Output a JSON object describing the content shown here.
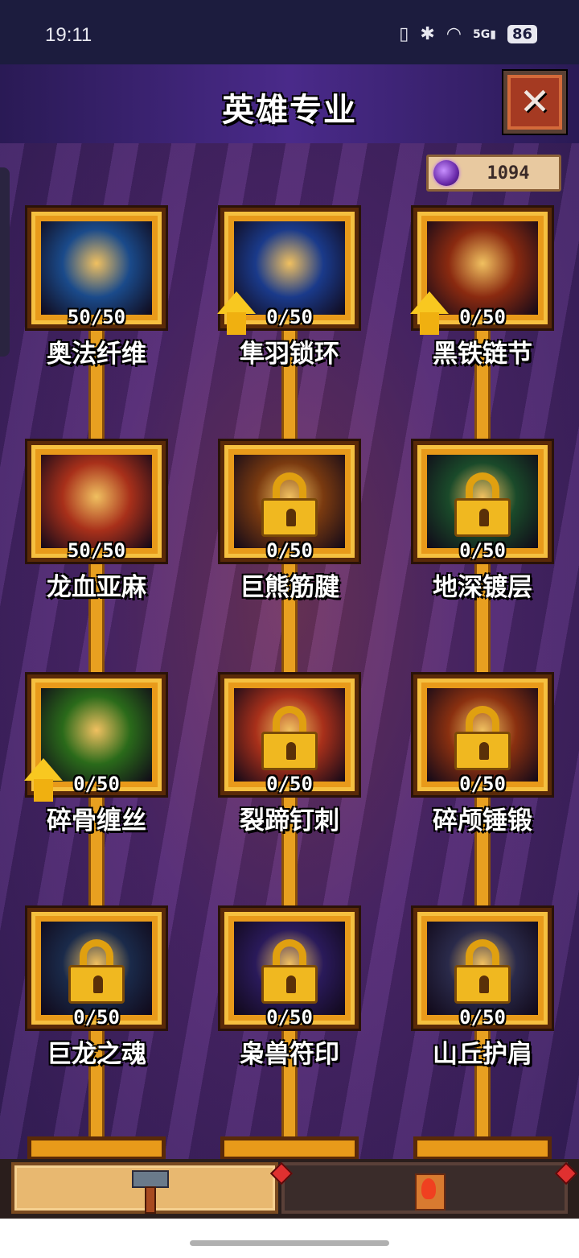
{
  "status_bar": {
    "time": "19:11",
    "icons": [
      "vibrate-icon",
      "bluetooth-icon",
      "wifi-icon",
      "signal-5g-icon"
    ],
    "network": "5G",
    "battery": "86"
  },
  "header": {
    "title": "英雄专业",
    "close_icon": "close-icon"
  },
  "currency": {
    "icon": "purple-orb-icon",
    "value": "1094"
  },
  "skills": [
    {
      "name": "奥法纤维",
      "progress": "50/50",
      "locked": false,
      "upgrade": false,
      "color": "#1a4a8a"
    },
    {
      "name": "隼羽锁环",
      "progress": "0/50",
      "locked": false,
      "upgrade": true,
      "color": "#1a3a8a"
    },
    {
      "name": "黑铁链节",
      "progress": "0/50",
      "locked": false,
      "upgrade": true,
      "color": "#8a2a10"
    },
    {
      "name": "龙血亚麻",
      "progress": "50/50",
      "locked": false,
      "upgrade": false,
      "color": "#a8301a"
    },
    {
      "name": "巨熊筋腱",
      "progress": "0/50",
      "locked": true,
      "upgrade": false,
      "color": "#7a3a10"
    },
    {
      "name": "地深镀层",
      "progress": "0/50",
      "locked": true,
      "upgrade": false,
      "color": "#1a4a2a"
    },
    {
      "name": "碎骨缠丝",
      "progress": "0/50",
      "locked": false,
      "upgrade": true,
      "color": "#2a6a1a"
    },
    {
      "name": "裂蹄钉刺",
      "progress": "0/50",
      "locked": true,
      "upgrade": false,
      "color": "#a8301a"
    },
    {
      "name": "碎颅锤锻",
      "progress": "0/50",
      "locked": true,
      "upgrade": false,
      "color": "#8a3010"
    },
    {
      "name": "巨龙之魂",
      "progress": "0/50",
      "locked": true,
      "upgrade": false,
      "color": "#1a2a4a"
    },
    {
      "name": "枭兽符印",
      "progress": "0/50",
      "locked": true,
      "upgrade": false,
      "color": "#2a1a5a"
    },
    {
      "name": "山丘护肩",
      "progress": "0/50",
      "locked": true,
      "upgrade": false,
      "color": "#2a2a4a"
    }
  ],
  "bottom_tabs": [
    {
      "icon": "hammer-icon",
      "active": true
    },
    {
      "icon": "scroll-icon",
      "active": false
    }
  ]
}
